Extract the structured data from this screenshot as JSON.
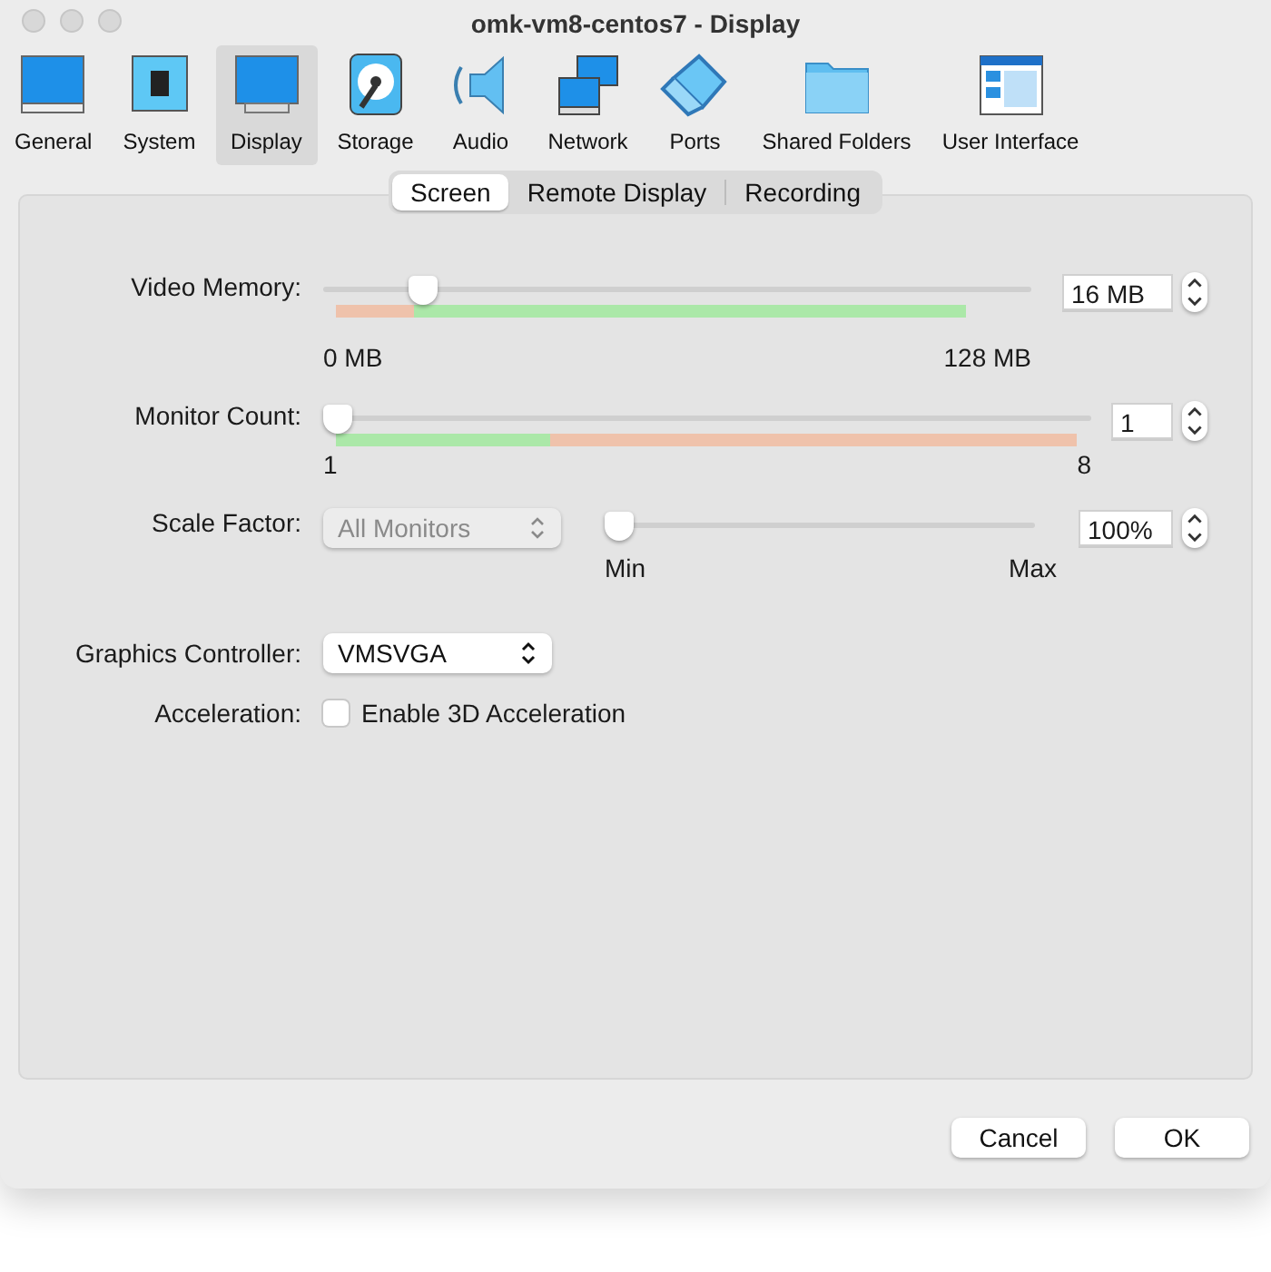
{
  "window": {
    "title": "omk-vm8-centos7 - Display"
  },
  "toolbar": [
    {
      "label": "General",
      "kind": "general",
      "selected": false
    },
    {
      "label": "System",
      "kind": "system",
      "selected": false
    },
    {
      "label": "Display",
      "kind": "display",
      "selected": true
    },
    {
      "label": "Storage",
      "kind": "storage",
      "selected": false
    },
    {
      "label": "Audio",
      "kind": "audio",
      "selected": false
    },
    {
      "label": "Network",
      "kind": "network",
      "selected": false
    },
    {
      "label": "Ports",
      "kind": "ports",
      "selected": false
    },
    {
      "label": "Shared Folders",
      "kind": "folder",
      "selected": false
    },
    {
      "label": "User Interface",
      "kind": "ui",
      "selected": false
    }
  ],
  "tabs": [
    {
      "label": "Screen",
      "selected": true
    },
    {
      "label": "Remote Display",
      "selected": false
    },
    {
      "label": "Recording",
      "selected": false
    }
  ],
  "video_memory": {
    "label": "Video Memory:",
    "level": 0.125,
    "value": "16 MB",
    "min_label": "0 MB",
    "max_label": "128 MB",
    "bands": [
      {
        "color": "#efc2ab",
        "level": 0.125
      },
      {
        "color": "#abe8a8",
        "level": 0.875
      }
    ]
  },
  "monitor_count": {
    "label": "Monitor Count:",
    "level": 0,
    "value": "1",
    "min_label": "1",
    "max_label": "8",
    "bands": [
      {
        "color": "#abe8a8",
        "level": 0.29
      },
      {
        "color": "#efc2ab",
        "level": 0.71
      }
    ]
  },
  "scale_factor": {
    "label": "Scale Factor:",
    "dropdown": {
      "value": "All Monitors",
      "disabled": true
    },
    "level": 0,
    "value": "100%",
    "min_label": "Min",
    "max_label": "Max"
  },
  "graphics_controller": {
    "label": "Graphics Controller:",
    "value": "VMSVGA"
  },
  "acceleration": {
    "label": "Acceleration:",
    "checkbox": {
      "label": "Enable 3D Acceleration",
      "checked": false
    }
  },
  "buttons": [
    "Cancel",
    "OK"
  ]
}
